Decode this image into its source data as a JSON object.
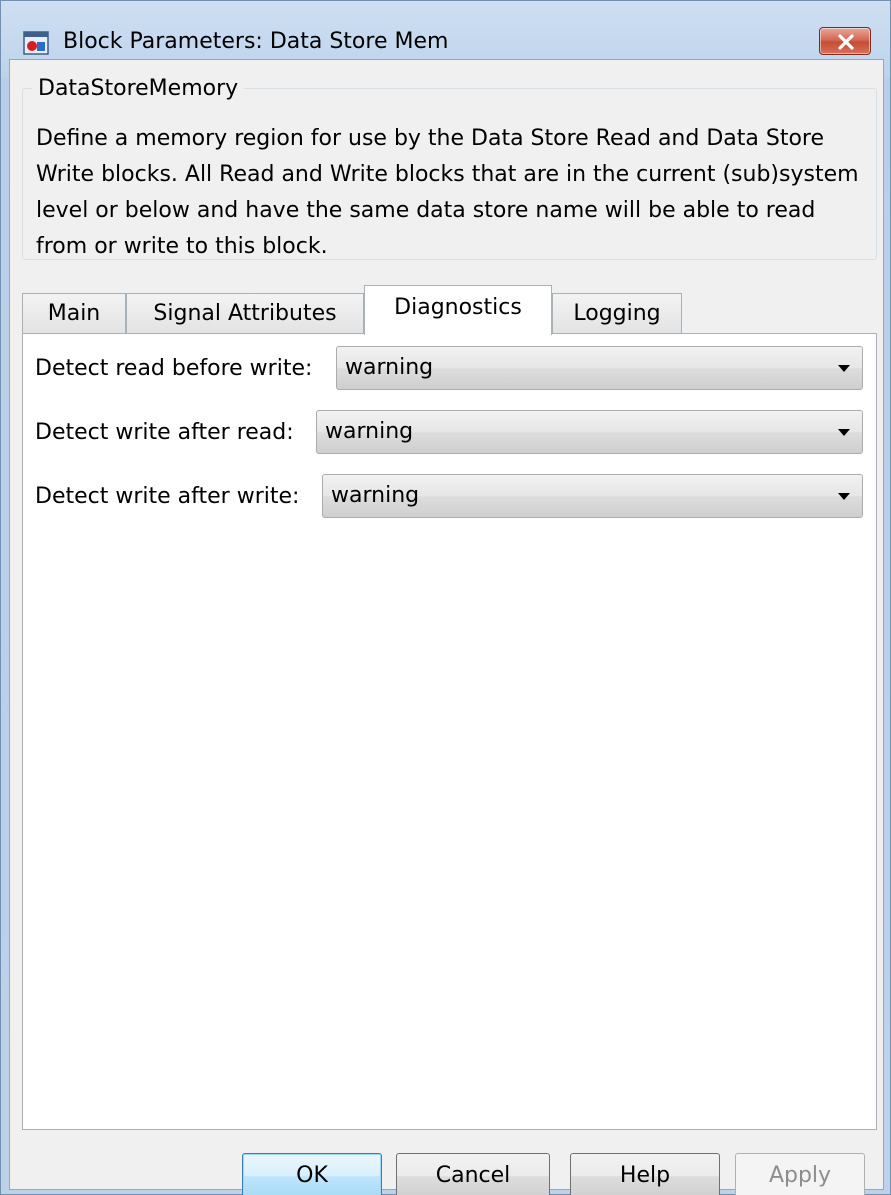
{
  "window": {
    "title": "Block Parameters: Data Store Mem",
    "app_icon": "simulink-block-icon",
    "close_icon": "close-icon"
  },
  "group": {
    "title": "DataStoreMemory",
    "description": "Define a memory region for use by the Data Store Read and Data Store Write blocks. All Read and Write blocks that are in the current (sub)system level or below and have the same data store name will be able to read from or write to this block."
  },
  "tabs": [
    {
      "label": "Main",
      "active": false
    },
    {
      "label": "Signal Attributes",
      "active": false
    },
    {
      "label": "Diagnostics",
      "active": true
    },
    {
      "label": "Logging",
      "active": false
    }
  ],
  "diagnostics": {
    "fields": [
      {
        "label": "Detect read before write:",
        "value": "warning"
      },
      {
        "label": "Detect write after read:",
        "value": "warning"
      },
      {
        "label": "Detect write after write:",
        "value": "warning"
      }
    ]
  },
  "buttons": {
    "ok": "OK",
    "cancel": "Cancel",
    "help": "Help",
    "apply": "Apply"
  },
  "colors": {
    "title_bar": "#bdd3ec",
    "close_button": "#c44d36",
    "default_button": "#bee6fd"
  }
}
